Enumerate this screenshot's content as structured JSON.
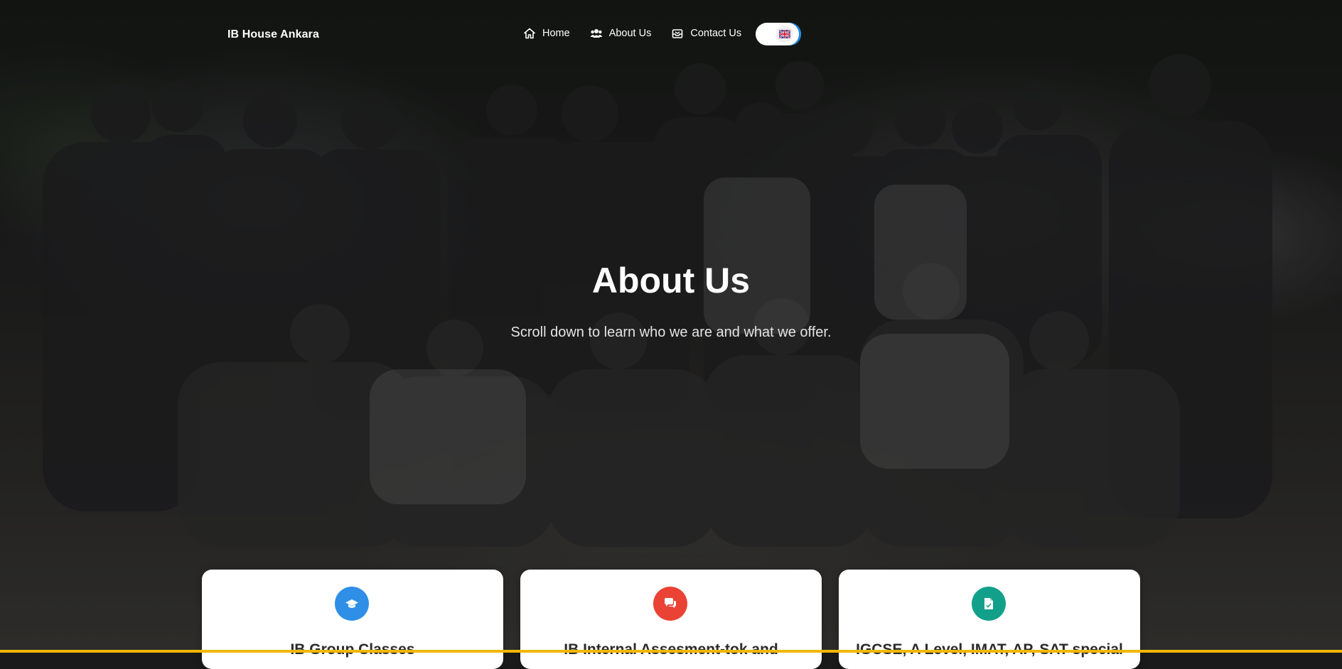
{
  "navbar": {
    "brand": "IB House Ankara",
    "links": [
      {
        "label": "Home",
        "icon": "home-icon"
      },
      {
        "label": "About Us",
        "icon": "users-icon"
      },
      {
        "label": "Contact Us",
        "icon": "inbox-icon"
      }
    ],
    "language_toggle": {
      "flag": "uk-flag-icon",
      "state": "English"
    }
  },
  "hero": {
    "title": "About Us",
    "subtitle": "Scroll down to learn who we are and what we offer."
  },
  "cards": [
    {
      "title": "IB Group Classes",
      "icon": "graduation-cap-icon",
      "color": "#2f8fe6"
    },
    {
      "title": "IB Internal Assesment-tok and",
      "icon": "chat-bubbles-icon",
      "color": "#ea4335"
    },
    {
      "title": "IGCSE, A Level, IMAT, AP, SAT special",
      "icon": "document-icon",
      "color": "#12a08b"
    }
  ],
  "colors": {
    "accent_bar": "#f2b705",
    "toggle_edge": "#1e88e5"
  }
}
